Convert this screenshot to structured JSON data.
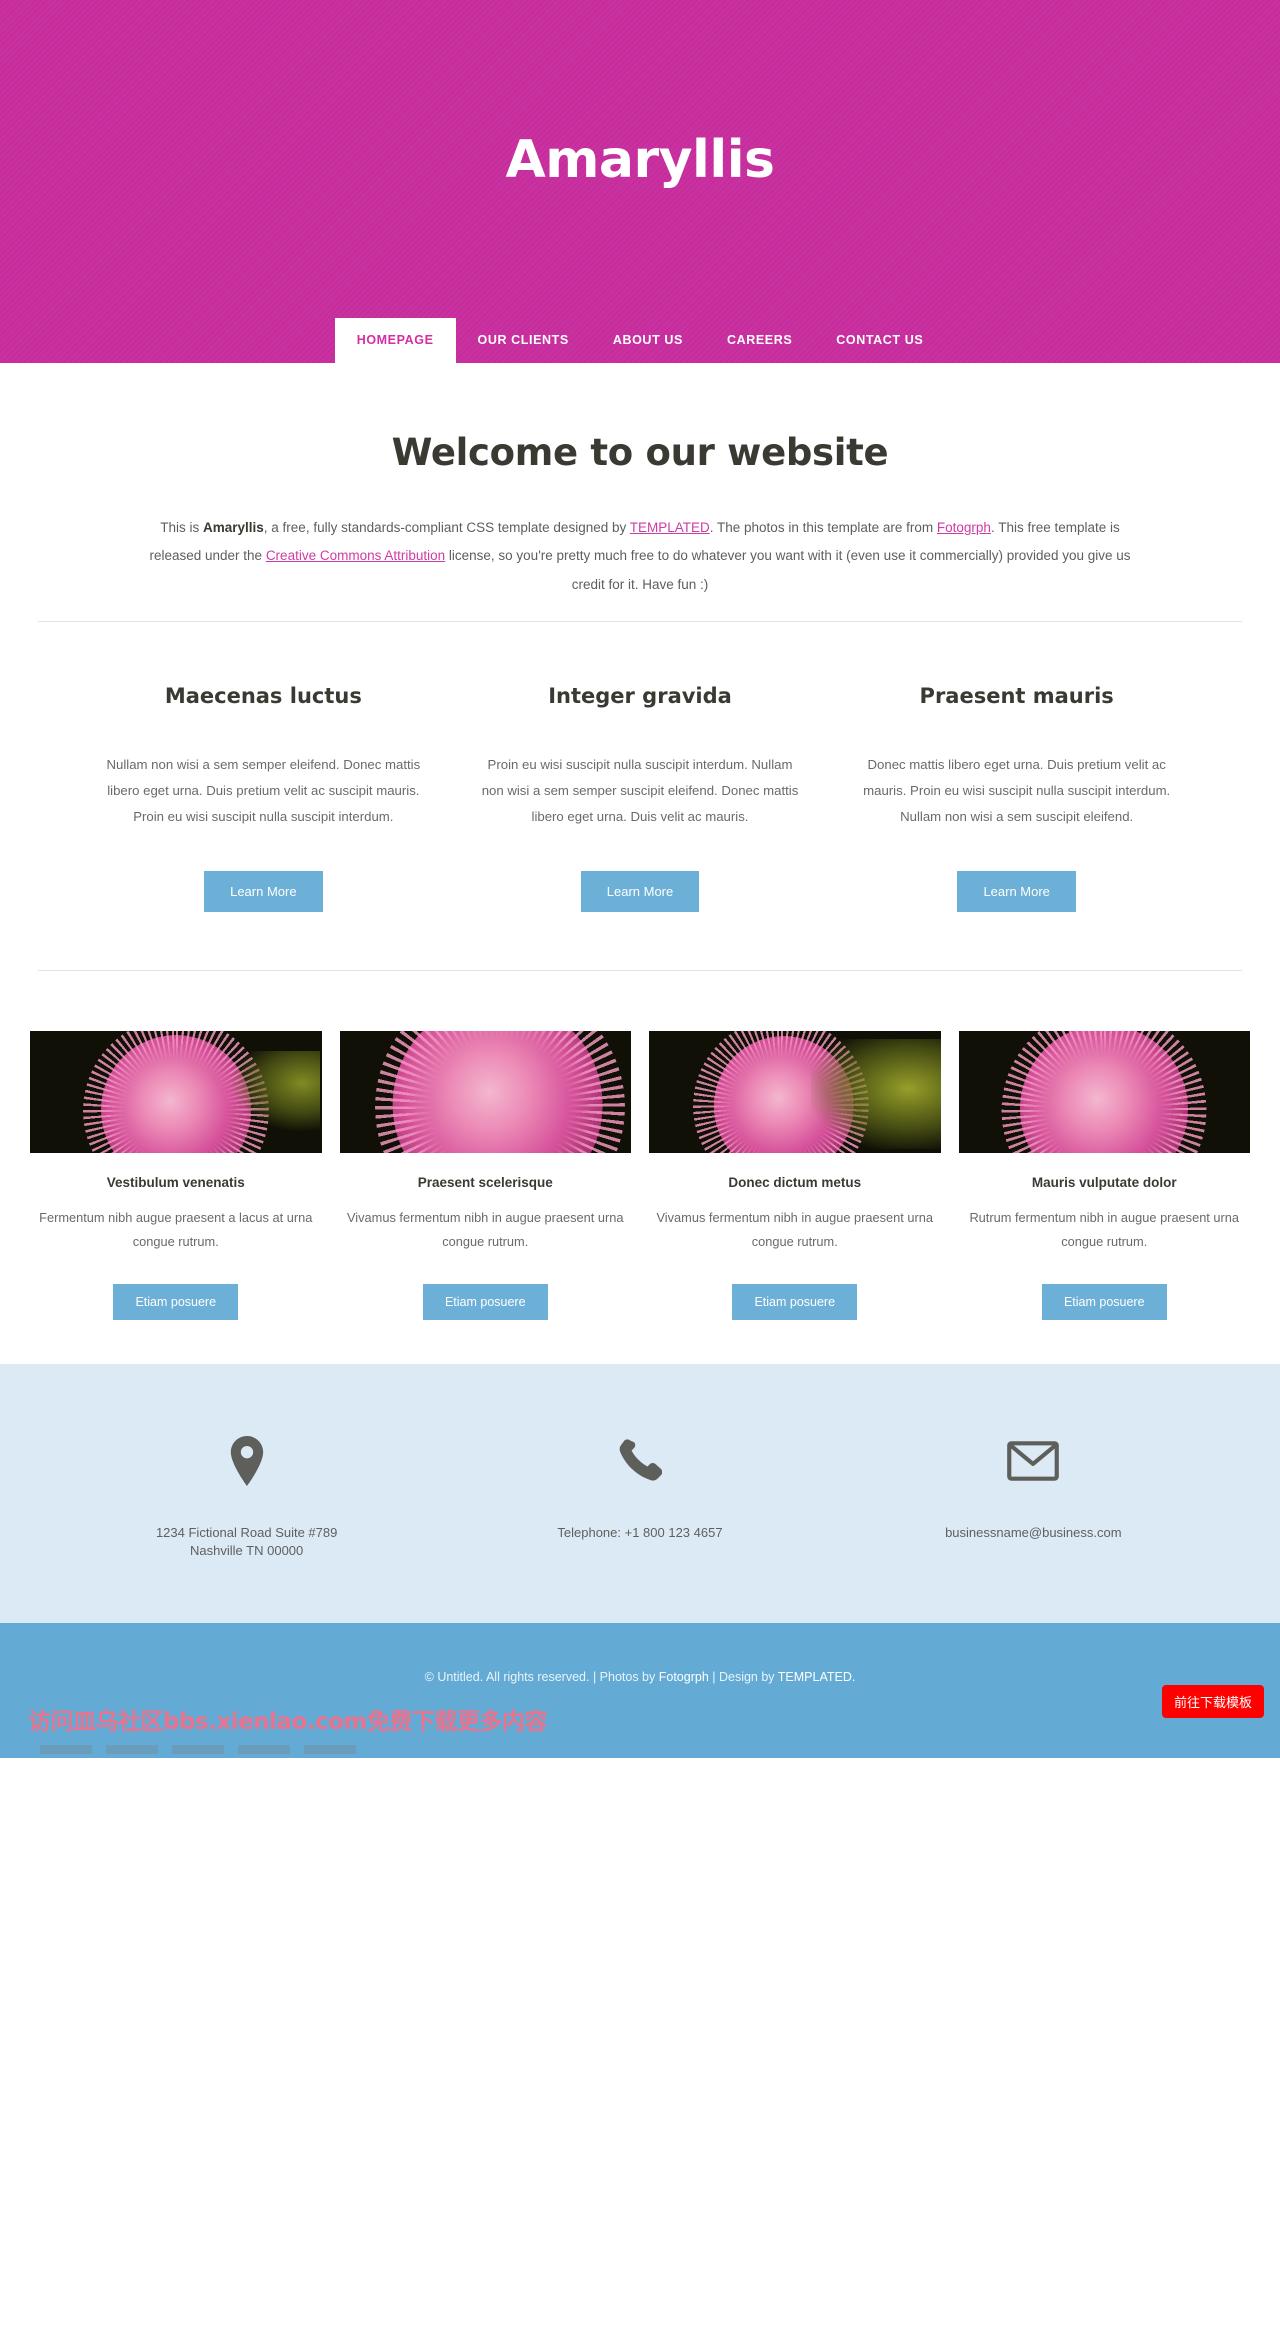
{
  "header": {
    "logo": "Amaryllis",
    "nav": [
      {
        "label": "HOMEPAGE",
        "active": true
      },
      {
        "label": "OUR CLIENTS",
        "active": false
      },
      {
        "label": "ABOUT US",
        "active": false
      },
      {
        "label": "CAREERS",
        "active": false
      },
      {
        "label": "CONTACT US",
        "active": false
      }
    ]
  },
  "banner": {
    "heading": "Welcome to our website",
    "text_1": "This is ",
    "strong_1": "Amaryllis",
    "text_2": ", a free, fully standards-compliant CSS template designed by ",
    "link_1": "TEMPLATED",
    "text_3": ". The photos in this template are from ",
    "link_2": "Fotogrph",
    "text_4": ". This free template is released under the ",
    "link_3": "Creative Commons Attribution",
    "text_5": " license, so you're pretty much free to do whatever you want with it (even use it commercially) provided you give us credit for it. Have fun :)"
  },
  "features": [
    {
      "title": "Maecenas luctus",
      "body": "Nullam non wisi a sem semper eleifend. Donec mattis libero eget urna. Duis pretium velit ac suscipit mauris. Proin eu wisi suscipit nulla suscipit interdum.",
      "button": "Learn More"
    },
    {
      "title": "Integer gravida",
      "body": "Proin eu wisi suscipit nulla suscipit interdum. Nullam non wisi a sem semper suscipit eleifend. Donec mattis libero eget urna. Duis velit ac mauris.",
      "button": "Learn More"
    },
    {
      "title": "Praesent mauris",
      "body": "Donec mattis libero eget urna. Duis pretium velit ac mauris. Proin eu wisi suscipit nulla suscipit interdum. Nullam non wisi a sem suscipit eleifend.",
      "button": "Learn More"
    }
  ],
  "gallery": [
    {
      "title": "Vestibulum venenatis",
      "body": "Fermentum nibh augue praesent a lacus at urna congue rutrum.",
      "button": "Etiam posuere",
      "image_alt": "pink-thistle-flower-photo"
    },
    {
      "title": "Praesent scelerisque",
      "body": "Vivamus fermentum nibh in augue praesent urna congue rutrum.",
      "button": "Etiam posuere",
      "image_alt": "pink-thistle-closeup-photo"
    },
    {
      "title": "Donec dictum metus",
      "body": "Vivamus fermentum nibh in augue praesent urna congue rutrum.",
      "button": "Etiam posuere",
      "image_alt": "pink-thistle-with-stem-photo"
    },
    {
      "title": "Mauris vulputate dolor",
      "body": "Rutrum fermentum nibh in augue praesent urna congue rutrum.",
      "button": "Etiam posuere",
      "image_alt": "pink-thistle-round-photo"
    }
  ],
  "contact": [
    {
      "icon": "location-pin-icon",
      "line_1": "1234 Fictional Road Suite #789",
      "line_2": "Nashville TN 00000"
    },
    {
      "icon": "phone-icon",
      "line_1": "Telephone: +1 800 123 4657",
      "line_2": ""
    },
    {
      "icon": "envelope-icon",
      "line_1": "businessname@business.com",
      "line_2": ""
    }
  ],
  "footer": {
    "copyright": "© Untitled. All rights reserved. | Photos by ",
    "link_photos": "Fotogrph",
    "separator": " | Design by ",
    "link_design": "TEMPLATED.",
    "download_button": "前往下载模板",
    "watermark": "访问皿乌社区bbs.xienlao.com免费下载更多内容"
  },
  "colors": {
    "header_pink": "#c92d9e",
    "nav_active_text": "#d42ea4",
    "button_blue": "#6cb0d8",
    "contact_bg": "#dceaf5",
    "footer_blue": "#63abd5",
    "link_pink": "#cf3ba5",
    "download_red": "#ff0000",
    "heading_dark": "#3a3a32"
  }
}
